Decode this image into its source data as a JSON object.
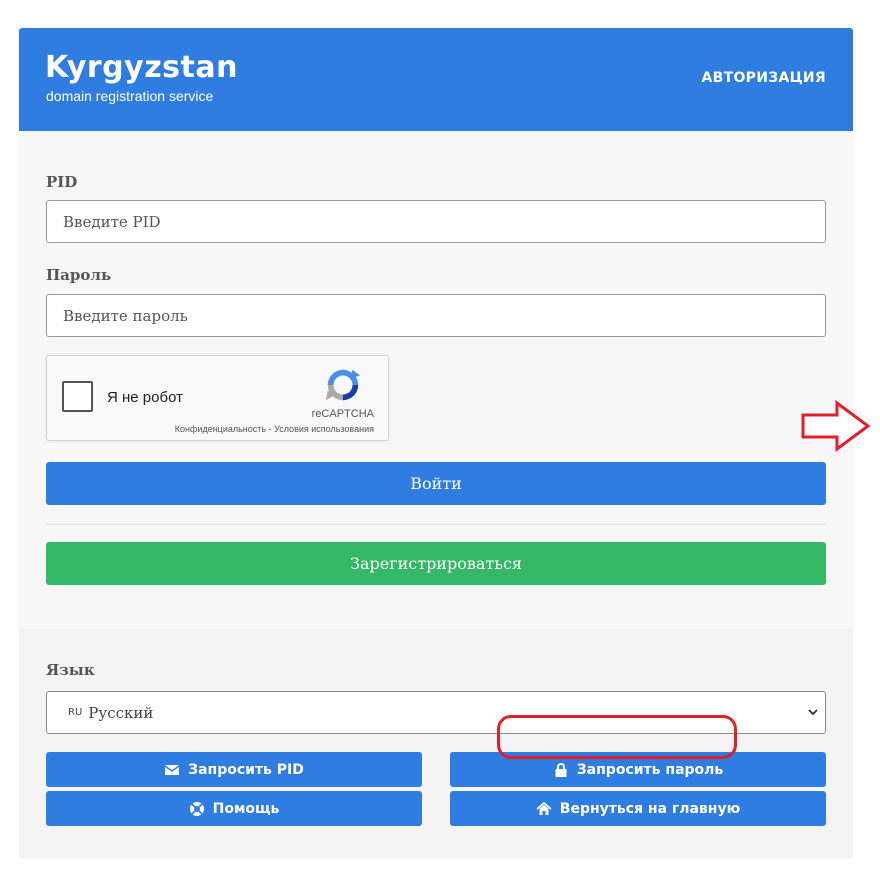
{
  "header": {
    "logo_title": "Kyrgyzstan",
    "logo_subtitle": "domain registration service",
    "page_label": "АВТОРИЗАЦИЯ"
  },
  "form": {
    "pid_label": "PID",
    "pid_placeholder": "Введите PID",
    "password_label": "Пароль",
    "password_placeholder": "Введите пароль",
    "captcha": {
      "checkbox_label": "Я не робот",
      "brand": "reCAPTCHA",
      "privacy": "Конфиденциальность",
      "separator": " - ",
      "terms": "Условия использования"
    },
    "login_button": "Войти",
    "register_button": "Зарегистрироваться"
  },
  "footer": {
    "language_label": "Язык",
    "language_code": "RU",
    "language_value": "Русский",
    "buttons": {
      "request_pid": "Запросить PID",
      "request_password": "Запросить пароль",
      "help": "Помощь",
      "back_home": "Вернуться на главную"
    }
  },
  "colors": {
    "primary": "#2f7de1",
    "success": "#33b866",
    "annotation": "#e01f2b"
  }
}
